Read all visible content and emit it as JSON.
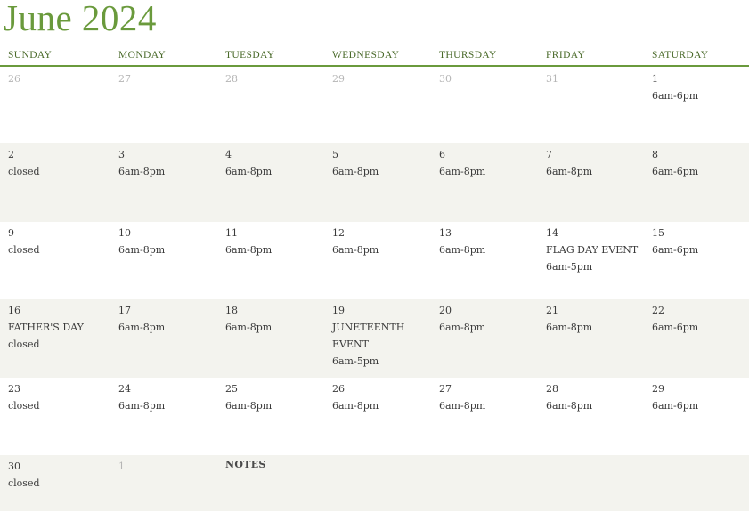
{
  "title": "June 2024",
  "weekdays": [
    "SUNDAY",
    "MONDAY",
    "TUESDAY",
    "WEDNESDAY",
    "THURSDAY",
    "FRIDAY",
    "SATURDAY"
  ],
  "weeks": [
    [
      {
        "day": "26",
        "muted": true,
        "lines": []
      },
      {
        "day": "27",
        "muted": true,
        "lines": []
      },
      {
        "day": "28",
        "muted": true,
        "lines": []
      },
      {
        "day": "29",
        "muted": true,
        "lines": []
      },
      {
        "day": "30",
        "muted": true,
        "lines": []
      },
      {
        "day": "31",
        "muted": true,
        "lines": []
      },
      {
        "day": "1",
        "muted": false,
        "lines": [
          "6am-6pm"
        ]
      }
    ],
    [
      {
        "day": "2",
        "muted": false,
        "lines": [
          "closed"
        ]
      },
      {
        "day": "3",
        "muted": false,
        "lines": [
          "6am-8pm"
        ]
      },
      {
        "day": "4",
        "muted": false,
        "lines": [
          "6am-8pm"
        ]
      },
      {
        "day": "5",
        "muted": false,
        "lines": [
          "6am-8pm"
        ]
      },
      {
        "day": "6",
        "muted": false,
        "lines": [
          "6am-8pm"
        ]
      },
      {
        "day": "7",
        "muted": false,
        "lines": [
          "6am-8pm"
        ]
      },
      {
        "day": "8",
        "muted": false,
        "lines": [
          "6am-6pm"
        ]
      }
    ],
    [
      {
        "day": "9",
        "muted": false,
        "lines": [
          "closed"
        ]
      },
      {
        "day": "10",
        "muted": false,
        "lines": [
          "6am-8pm"
        ]
      },
      {
        "day": "11",
        "muted": false,
        "lines": [
          "6am-8pm"
        ]
      },
      {
        "day": "12",
        "muted": false,
        "lines": [
          "6am-8pm"
        ]
      },
      {
        "day": "13",
        "muted": false,
        "lines": [
          "6am-8pm"
        ]
      },
      {
        "day": "14",
        "muted": false,
        "lines": [
          "FLAG DAY EVENT",
          "6am-5pm"
        ]
      },
      {
        "day": "15",
        "muted": false,
        "lines": [
          "6am-6pm"
        ]
      }
    ],
    [
      {
        "day": "16",
        "muted": false,
        "lines": [
          "FATHER'S DAY",
          "closed"
        ]
      },
      {
        "day": "17",
        "muted": false,
        "lines": [
          "6am-8pm"
        ]
      },
      {
        "day": "18",
        "muted": false,
        "lines": [
          "6am-8pm"
        ]
      },
      {
        "day": "19",
        "muted": false,
        "lines": [
          "JUNETEENTH EVENT",
          "6am-5pm"
        ]
      },
      {
        "day": "20",
        "muted": false,
        "lines": [
          "6am-8pm"
        ]
      },
      {
        "day": "21",
        "muted": false,
        "lines": [
          "6am-8pm"
        ]
      },
      {
        "day": "22",
        "muted": false,
        "lines": [
          "6am-6pm"
        ]
      }
    ],
    [
      {
        "day": "23",
        "muted": false,
        "lines": [
          "closed"
        ]
      },
      {
        "day": "24",
        "muted": false,
        "lines": [
          "6am-8pm"
        ]
      },
      {
        "day": "25",
        "muted": false,
        "lines": [
          "6am-8pm"
        ]
      },
      {
        "day": "26",
        "muted": false,
        "lines": [
          "6am-8pm"
        ]
      },
      {
        "day": "27",
        "muted": false,
        "lines": [
          "6am-8pm"
        ]
      },
      {
        "day": "28",
        "muted": false,
        "lines": [
          "6am-8pm"
        ]
      },
      {
        "day": "29",
        "muted": false,
        "lines": [
          "6am-6pm"
        ]
      }
    ],
    [
      {
        "day": "30",
        "muted": false,
        "lines": [
          "closed"
        ]
      },
      {
        "day": "1",
        "muted": true,
        "lines": []
      }
    ]
  ],
  "notes_label": "NOTES",
  "colors": {
    "accent": "#6a9a3c",
    "shade": "#f3f3ee",
    "muted": "#b5b5b5"
  }
}
